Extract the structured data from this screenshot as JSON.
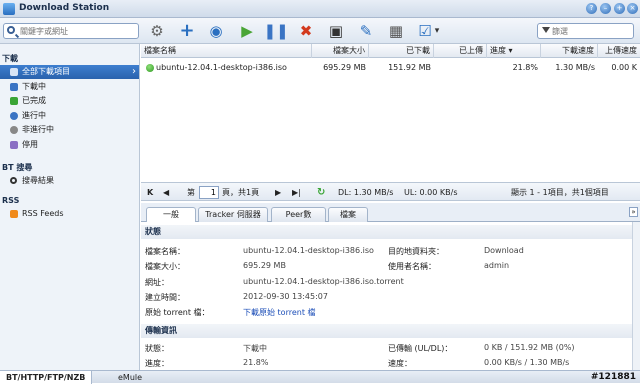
{
  "window": {
    "title": "Download Station"
  },
  "search": {
    "placeholder": "關鍵字或網址"
  },
  "filter": {
    "placeholder": "篩選"
  },
  "toolbar": {
    "icons": [
      "gear-icon",
      "add-icon",
      "add-url-icon",
      "resume-icon",
      "pause-icon",
      "delete-icon",
      "save-icon",
      "edit-icon",
      "calculator-icon",
      "select-icon"
    ]
  },
  "sidebar": {
    "download_section": "下載",
    "items": [
      {
        "label": "全部下載項目"
      },
      {
        "label": "下載中"
      },
      {
        "label": "已完成"
      },
      {
        "label": "進行中"
      },
      {
        "label": "非進行中"
      },
      {
        "label": "停用"
      }
    ],
    "bt_section": "BT 搜尋",
    "bt_items": [
      {
        "label": "搜尋結果"
      }
    ],
    "rss_section": "RSS",
    "rss_items": [
      {
        "label": "RSS Feeds"
      }
    ]
  },
  "table": {
    "headers": [
      "檔案名稱",
      "檔案大小",
      "已下載",
      "已上傳",
      "進度 ▾",
      "下載速度",
      "上傳速度"
    ],
    "rows": [
      {
        "name": "ubuntu-12.04.1-desktop-i386.iso",
        "size": "695.29 MB",
        "downloaded": "151.92 MB",
        "uploaded": "",
        "progress": "21.8%",
        "dl_speed": "1.30 MB/s",
        "ul_speed": "0.00 K"
      }
    ]
  },
  "pager": {
    "first": "K",
    "prev": "◀",
    "page_prefix": "第",
    "page_value": "1",
    "page_suffix": "頁，共1頁",
    "next": "▶",
    "last": "▶|",
    "dl": "DL: 1.30 MB/s",
    "ul": "UL: 0.00 KB/s",
    "summary": "顯示 1 - 1項目，共1個項目"
  },
  "detail_tabs": [
    "一般",
    "Tracker 伺服器",
    "Peer數",
    "檔案"
  ],
  "status_section": {
    "title": "狀態",
    "file_name_label": "檔案名稱：",
    "file_name": "ubuntu-12.04.1-desktop-i386.iso",
    "dest_label": "目的地資料夾：",
    "dest": "Download",
    "size_label": "檔案大小：",
    "size": "695.29 MB",
    "user_label": "使用者名稱：",
    "user": "admin",
    "url_label": "網址：",
    "url": "ubuntu-12.04.1-desktop-i386.iso.torrent",
    "created_label": "建立時間：",
    "created": "2012-09-30 13:45:07",
    "torrent_label": "原始 torrent 檔：",
    "torrent": "下載原始 torrent 檔"
  },
  "transfer_section": {
    "title": "傳輸資訊",
    "status_label": "狀態：",
    "status": "下載中",
    "transferred_label": "已傳輸 (UL/DL)：",
    "transferred": "0 KB / 151.92 MB (0%)",
    "progress_label": "進度：",
    "progress": "21.8%",
    "speed_label": "速度：",
    "speed": "0.00 KB/s / 1.30 MB/s"
  },
  "bottom_tabs": [
    "BT/HTTP/FTP/NZB",
    "eMule"
  ],
  "watermark": "#121881",
  "colors": {
    "accent": "#2a62ad",
    "sidebar_bg": "#eef3f9"
  }
}
